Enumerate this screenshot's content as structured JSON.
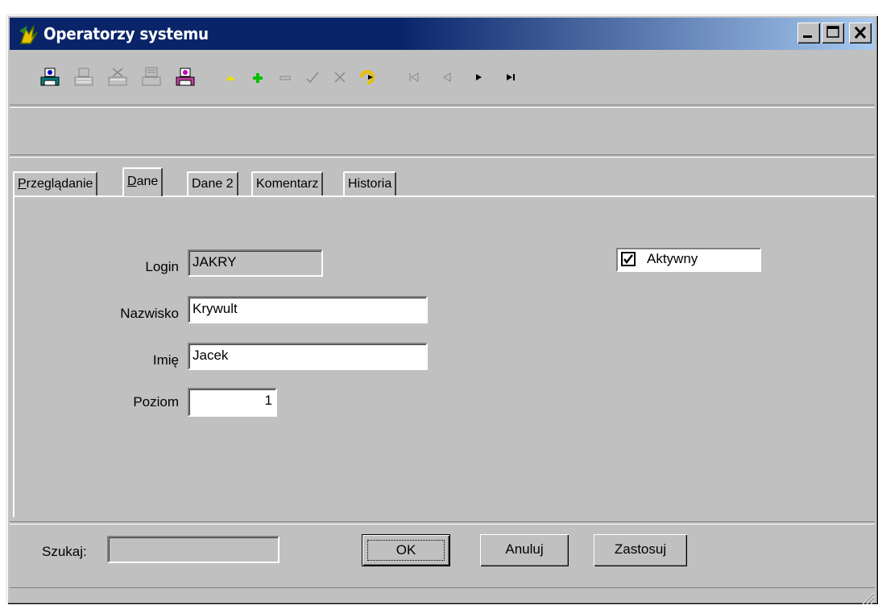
{
  "window": {
    "title": "Operatorzy systemu",
    "controls": [
      "minimize-icon",
      "maximize-icon",
      "close-icon"
    ]
  },
  "toolbar": {
    "icons": [
      "print-icon",
      "print-preview-icon",
      "print-setup-icon",
      "report-icon",
      "export-icon",
      "arrow-up-icon",
      "add-record-icon",
      "delete-record-icon",
      "post-record-icon",
      "cancel-record-icon",
      "refresh-icon",
      "first-record-icon",
      "prior-record-icon",
      "next-record-icon",
      "last-record-icon"
    ]
  },
  "tabs": [
    {
      "label_first": "P",
      "label_rest": "rzeglądanie",
      "active": false
    },
    {
      "label_first": "D",
      "label_rest": "ane",
      "active": true
    },
    {
      "label": "Dane 2",
      "active": false
    },
    {
      "label": "Komentarz",
      "active": false
    },
    {
      "label": "Historia",
      "active": false
    }
  ],
  "form": {
    "login": {
      "label": "Login",
      "value": "JAKRY"
    },
    "nazwisko": {
      "label": "Nazwisko",
      "value": "Krywult"
    },
    "imie": {
      "label": "Imię",
      "value": "Jacek"
    },
    "poziom": {
      "label": "Poziom",
      "value": "1"
    },
    "aktywny": {
      "label": "Aktywny",
      "checked": true
    }
  },
  "bottom": {
    "search_label": "Szukaj:",
    "search_value": "",
    "ok_label": "OK",
    "cancel_label": "Anuluj",
    "apply_label": "Zastosuj"
  },
  "colors": {
    "title_start": "#0a246a",
    "title_end": "#a6caf0",
    "face": "#c0c0c0"
  }
}
